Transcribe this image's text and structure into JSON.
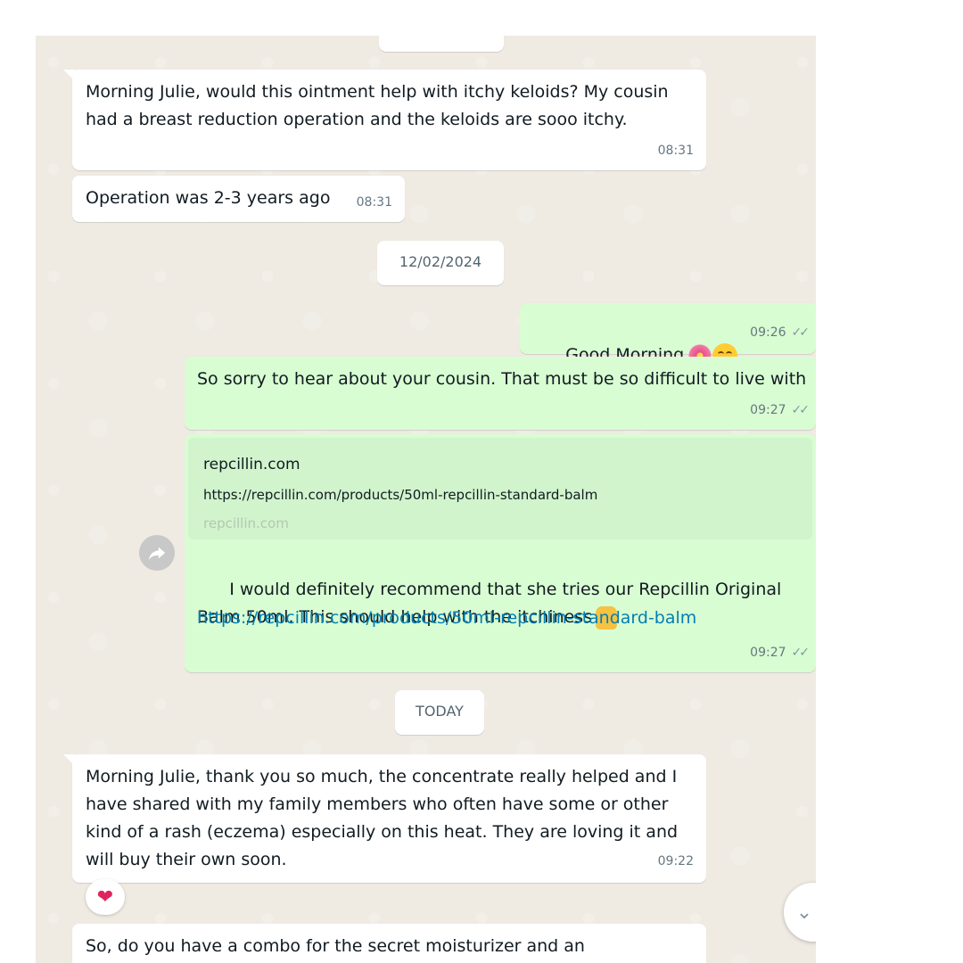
{
  "messages": {
    "m1": {
      "text": "Morning Julie, would this ointment help with itchy keloids? My cousin had a breast reduction operation and the keloids are sooo itchy.",
      "time": "08:31"
    },
    "m2": {
      "text": "Operation was 2-3 years ago",
      "time": "08:31"
    },
    "m3": {
      "text": "Good Morning",
      "time": "09:26"
    },
    "m4": {
      "text": "So sorry to hear about your cousin. That must be so difficult to live with",
      "time": "09:27"
    },
    "m5": {
      "preview_title": "repcillin.com",
      "preview_url": "https://repcillin.com/products/50ml-repcillin-standard-balm",
      "preview_domain": "repcillin.com",
      "text": "I would definitely recommend that she tries our Repcillin Original Balm 50ml. This should help with the itchiness",
      "link": "https://repcillin.com/products/50ml-repcillin-standard-balm",
      "time": "09:27"
    },
    "m6": {
      "text": "Morning Julie, thank you so much, the concentrate really helped and I have shared with my family members who often have some or other kind of a rash (eczema) especially on this heat. They are loving it and will buy their own soon.",
      "time": "09:22",
      "reaction": "❤"
    },
    "m7": {
      "text": "So, do you have a combo for the secret moisturizer and an"
    }
  },
  "dates": {
    "d1": "12/02/2024",
    "d2": "TODAY"
  },
  "icons": {
    "ticks": "double-check-icon",
    "forward": "forward-icon",
    "scroll": "chevron-down-icon"
  },
  "colors": {
    "incoming": "#ffffff",
    "outgoing": "#d9fdd3",
    "link": "#027eb5",
    "background": "#efeae2"
  }
}
